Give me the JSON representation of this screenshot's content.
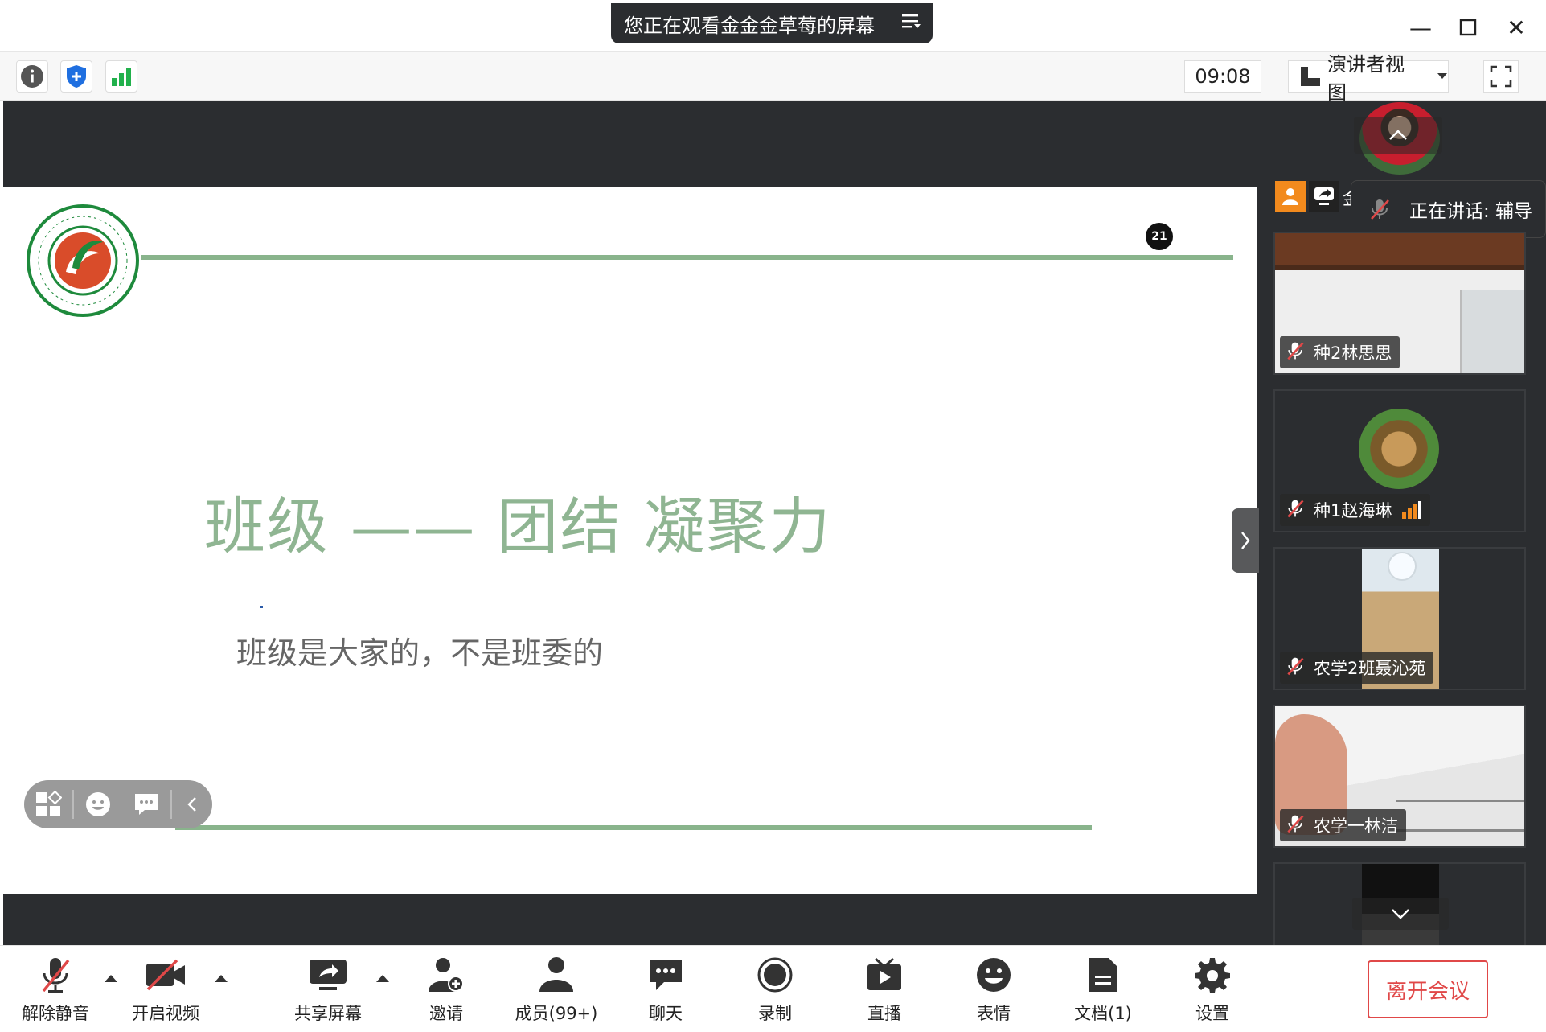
{
  "window": {
    "share_banner": "您正在观看金金金草莓的屏幕",
    "minimize": "—",
    "maximize": "☐",
    "close": "✕"
  },
  "toolbar": {
    "timer": "09:08",
    "view_label": "演讲者视图"
  },
  "slide": {
    "page_number": "21",
    "title": "班级 —— 团结 凝聚力",
    "subtitle": "班级是大家的，不是班委的",
    "accent_color": "#89b48c"
  },
  "speaking": {
    "label": "正在讲话: 辅导"
  },
  "participants": [
    {
      "name": "种2林思思"
    },
    {
      "name": "种1赵海琳"
    },
    {
      "name": "农学2班聂沁苑"
    },
    {
      "name": "农学一林洁"
    }
  ],
  "host_tile": {
    "name": "金"
  },
  "bottombar": {
    "unmute": "解除静音",
    "start_video": "开启视频",
    "share_screen": "共享屏幕",
    "invite": "邀请",
    "members": "成员(99+)",
    "chat": "聊天",
    "record": "录制",
    "live": "直播",
    "reactions": "表情",
    "docs": "文档(1)",
    "settings": "设置",
    "leave": "离开会议"
  }
}
